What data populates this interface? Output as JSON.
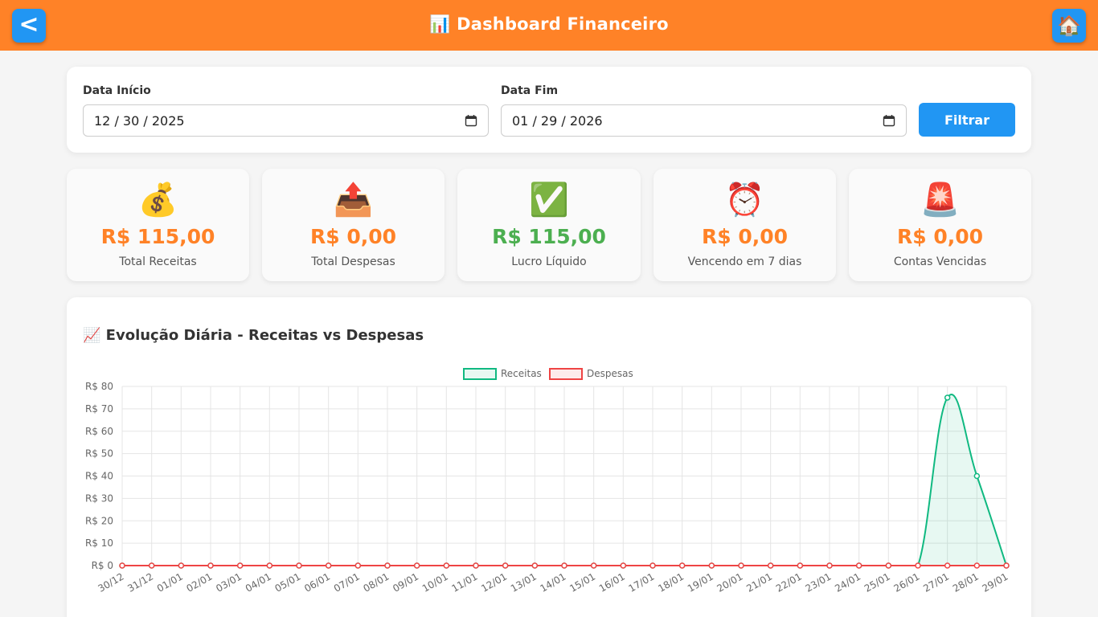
{
  "header": {
    "title": "📊 Dashboard Financeiro",
    "back_label": "<",
    "home_icon": "🏠"
  },
  "filters": {
    "start_label": "Data Início",
    "start_value": "12 / 30 / 2025",
    "end_label": "Data Fim",
    "end_value": "01 / 29 / 2026",
    "button_label": "Filtrar"
  },
  "stats": [
    {
      "icon": "💰",
      "icon_name": "money-bag-icon",
      "value": "R$ 115,00",
      "label": "Total Receitas",
      "color": "#ff8227"
    },
    {
      "icon": "📤",
      "icon_name": "outbox-tray-icon",
      "value": "R$ 0,00",
      "label": "Total Despesas",
      "color": "#ff8227"
    },
    {
      "icon": "✅",
      "icon_name": "check-mark-icon",
      "value": "R$ 115,00",
      "label": "Lucro Líquido",
      "color": "#4caf50"
    },
    {
      "icon": "⏰",
      "icon_name": "alarm-clock-icon",
      "value": "R$ 0,00",
      "label": "Vencendo em 7 dias",
      "color": "#ff8227"
    },
    {
      "icon": "🚨",
      "icon_name": "siren-icon",
      "value": "R$ 0,00",
      "label": "Contas Vencidas",
      "color": "#ff8227"
    }
  ],
  "colors": {
    "accent": "#ff8227",
    "primary": "#2196f3",
    "receitas": "#10b981",
    "despesas": "#ef4444"
  },
  "chart_data": {
    "type": "line",
    "title": "📈 Evolução Diária - Receitas vs Despesas",
    "categories": [
      "30/12",
      "31/12",
      "01/01",
      "02/01",
      "03/01",
      "04/01",
      "05/01",
      "06/01",
      "07/01",
      "08/01",
      "09/01",
      "10/01",
      "11/01",
      "12/01",
      "13/01",
      "14/01",
      "15/01",
      "16/01",
      "17/01",
      "18/01",
      "19/01",
      "20/01",
      "21/01",
      "22/01",
      "23/01",
      "24/01",
      "25/01",
      "26/01",
      "27/01",
      "28/01",
      "29/01"
    ],
    "series": [
      {
        "name": "Receitas",
        "color": "#10b981",
        "values": [
          0,
          0,
          0,
          0,
          0,
          0,
          0,
          0,
          0,
          0,
          0,
          0,
          0,
          0,
          0,
          0,
          0,
          0,
          0,
          0,
          0,
          0,
          0,
          0,
          0,
          0,
          0,
          0,
          75,
          40,
          0
        ]
      },
      {
        "name": "Despesas",
        "color": "#ef4444",
        "values": [
          0,
          0,
          0,
          0,
          0,
          0,
          0,
          0,
          0,
          0,
          0,
          0,
          0,
          0,
          0,
          0,
          0,
          0,
          0,
          0,
          0,
          0,
          0,
          0,
          0,
          0,
          0,
          0,
          0,
          0,
          0
        ]
      }
    ],
    "yticks": [
      "R$ 0",
      "R$ 10",
      "R$ 20",
      "R$ 30",
      "R$ 40",
      "R$ 50",
      "R$ 60",
      "R$ 70",
      "R$ 80"
    ],
    "ylim": [
      0,
      80
    ],
    "grid": true,
    "legend": "top-center"
  }
}
